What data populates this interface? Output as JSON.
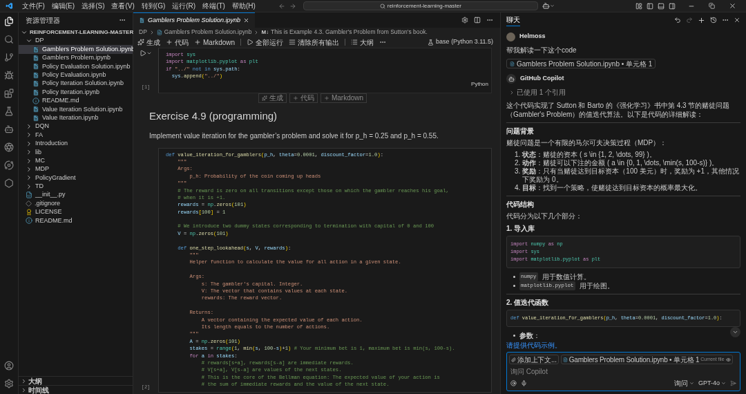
{
  "title_bar": {
    "menus": [
      "文件(F)",
      "编辑(E)",
      "选择(S)",
      "查看(V)",
      "转到(G)",
      "运行(R)",
      "终端(T)",
      "帮助(H)"
    ],
    "search": "reinforcement-learning-master"
  },
  "explorer": {
    "title": "资源管理器",
    "root": {
      "label": "REINFORCEMENT-LEARNING-MASTER",
      "expanded": true,
      "children": [
        {
          "kind": "folder",
          "label": "DP",
          "expanded": true,
          "selected": false,
          "children": [
            {
              "kind": "notebook",
              "label": "Gamblers Problem Solution.ipynb",
              "selected": true
            },
            {
              "kind": "notebook",
              "label": "Gamblers Problem.ipynb",
              "selected": false
            },
            {
              "kind": "notebook",
              "label": "Policy Evaluation Solution.ipynb",
              "selected": false
            },
            {
              "kind": "notebook",
              "label": "Policy Evaluation.ipynb",
              "selected": false
            },
            {
              "kind": "notebook",
              "label": "Policy Iteration Solution.ipynb",
              "selected": false
            },
            {
              "kind": "notebook",
              "label": "Policy Iteration.ipynb",
              "selected": false
            },
            {
              "kind": "info",
              "label": "README.md",
              "selected": false
            },
            {
              "kind": "notebook",
              "label": "Value Iteration Solution.ipynb",
              "selected": false
            },
            {
              "kind": "notebook",
              "label": "Value Iteration.ipynb",
              "selected": false
            }
          ]
        },
        {
          "kind": "folder",
          "label": "DQN",
          "expanded": false,
          "selected": false
        },
        {
          "kind": "folder",
          "label": "FA",
          "expanded": false,
          "selected": false
        },
        {
          "kind": "folder",
          "label": "Introduction",
          "expanded": false,
          "selected": false
        },
        {
          "kind": "folder",
          "label": "lib",
          "expanded": false,
          "selected": false
        },
        {
          "kind": "folder",
          "label": "MC",
          "expanded": false,
          "selected": false
        },
        {
          "kind": "folder",
          "label": "MDP",
          "expanded": false,
          "selected": false
        },
        {
          "kind": "folder",
          "label": "PolicyGradient",
          "expanded": false,
          "selected": false
        },
        {
          "kind": "folder",
          "label": "TD",
          "expanded": false,
          "selected": false
        },
        {
          "kind": "python",
          "label": "__init__.py",
          "selected": false
        },
        {
          "kind": "git",
          "label": ".gitignore",
          "selected": false
        },
        {
          "kind": "license",
          "label": "LICENSE",
          "selected": false
        },
        {
          "kind": "info",
          "label": "README.md",
          "selected": false
        }
      ]
    }
  },
  "bottom_sections": [
    {
      "label": "大纲",
      "expanded": false
    },
    {
      "label": "时间线",
      "expanded": false
    }
  ],
  "editor": {
    "tabs": [
      {
        "label": "Gamblers Problem Solution.ipynb",
        "selected": true
      }
    ],
    "breadcrumb": [
      "DP",
      "Gamblers Problem Solution.ipynb"
    ],
    "breadcrumb_badge": "M↓",
    "breadcrumb_cell": "This is Example 4.3. Gambler's Problem from Sutton's book.",
    "toolbar": [
      {
        "kind": "generate",
        "label": "生成"
      },
      {
        "kind": "add",
        "label": "代码"
      },
      {
        "kind": "add",
        "label": "Markdown"
      },
      {
        "kind": "separator"
      },
      {
        "kind": "run",
        "label": "全部运行"
      },
      {
        "kind": "clear",
        "label": "清除所有输出"
      },
      {
        "kind": "separator"
      },
      {
        "kind": "outline",
        "label": "大纲"
      },
      {
        "kind": "more"
      }
    ],
    "kernel": "base (Python 3.11.5)",
    "cells": [
      {
        "kind": "code",
        "focused": true,
        "exec": "[1]",
        "language": "Python",
        "lines": [
          {
            "kind": "code",
            "tokens": [
              {
                "kind": "ctl",
                "text": "import"
              },
              {
                "kind": "mod",
                "text": " sys"
              }
            ]
          },
          {
            "kind": "code",
            "tokens": [
              {
                "kind": "ctl",
                "text": "import"
              },
              {
                "kind": "mod",
                "text": " matplotlib.pyplot"
              },
              {
                "kind": "ctl",
                "text": " as"
              },
              {
                "kind": "mod",
                "text": " plt"
              }
            ]
          },
          {
            "kind": "code",
            "tokens": [
              {
                "kind": "ctl",
                "text": "if"
              },
              {
                "kind": "str",
                "text": " \"../\""
              },
              {
                "kind": "kw",
                "text": " not in"
              },
              {
                "kind": "var",
                "text": " sys"
              },
              {
                "kind": "plain",
                "text": "."
              },
              {
                "kind": "var",
                "text": "path"
              },
              {
                "kind": "plain",
                "text": ":"
              }
            ]
          },
          {
            "kind": "code",
            "tokens": [
              {
                "kind": "var",
                "text": "  sys"
              },
              {
                "kind": "plain",
                "text": "."
              },
              {
                "kind": "fn",
                "text": "append"
              },
              {
                "kind": "brk",
                "text": "("
              },
              {
                "kind": "str",
                "text": "\"../\""
              },
              {
                "kind": "brk",
                "text": ")"
              }
            ]
          }
        ]
      },
      {
        "kind": "insert_bar",
        "items": [
          "生成",
          "代码",
          "Markdown"
        ]
      },
      {
        "kind": "markdown",
        "heading": "Exercise 4.9 (programming)",
        "text": "Implement value iteration for the gambler’s problem and solve it for p_h = 0.25 and p_h = 0.55."
      },
      {
        "kind": "code",
        "focused": false,
        "exec": "[2]",
        "lines": [
          {
            "kind": "code",
            "tokens": [
              {
                "kind": "kw",
                "text": "def"
              },
              {
                "kind": "fn",
                "text": " value_iteration_for_gamblers"
              },
              {
                "kind": "brk",
                "text": "("
              },
              {
                "kind": "var",
                "text": "p_h"
              },
              {
                "kind": "plain",
                "text": ", "
              },
              {
                "kind": "var",
                "text": "theta"
              },
              {
                "kind": "plain",
                "text": "="
              },
              {
                "kind": "num",
                "text": "0.0001"
              },
              {
                "kind": "plain",
                "text": ", "
              },
              {
                "kind": "var",
                "text": "discount_factor"
              },
              {
                "kind": "plain",
                "text": "="
              },
              {
                "kind": "num",
                "text": "1.0"
              },
              {
                "kind": "brk",
                "text": ")"
              },
              {
                "kind": "plain",
                "text": ":"
              }
            ]
          },
          {
            "kind": "doc",
            "text": "    \"\"\""
          },
          {
            "kind": "doc",
            "text": "    Args:"
          },
          {
            "kind": "doc",
            "text": "        p_h: Probability of the coin coming up heads"
          },
          {
            "kind": "doc",
            "text": "    \"\"\""
          },
          {
            "kind": "cmt",
            "text": "    # The reward is zero on all transitions except those on which the gambler reaches his goal,"
          },
          {
            "kind": "cmt",
            "text": "    # when it is +1."
          },
          {
            "kind": "code",
            "tokens": [
              {
                "kind": "var",
                "text": "    rewards"
              },
              {
                "kind": "plain",
                "text": " = "
              },
              {
                "kind": "mod",
                "text": "np"
              },
              {
                "kind": "plain",
                "text": "."
              },
              {
                "kind": "fn",
                "text": "zeros"
              },
              {
                "kind": "brk",
                "text": "("
              },
              {
                "kind": "num",
                "text": "101"
              },
              {
                "kind": "brk",
                "text": ")"
              }
            ]
          },
          {
            "kind": "code",
            "tokens": [
              {
                "kind": "var",
                "text": "    rewards"
              },
              {
                "kind": "brk",
                "text": "["
              },
              {
                "kind": "num",
                "text": "100"
              },
              {
                "kind": "brk",
                "text": "]"
              },
              {
                "kind": "plain",
                "text": " = "
              },
              {
                "kind": "num",
                "text": "1"
              }
            ]
          },
          {
            "kind": "blank"
          },
          {
            "kind": "cmt",
            "text": "    # We introduce two dummy states corresponding to termination with capital of 0 and 100"
          },
          {
            "kind": "code",
            "tokens": [
              {
                "kind": "var",
                "text": "    V"
              },
              {
                "kind": "plain",
                "text": " = "
              },
              {
                "kind": "mod",
                "text": "np"
              },
              {
                "kind": "plain",
                "text": "."
              },
              {
                "kind": "fn",
                "text": "zeros"
              },
              {
                "kind": "brk",
                "text": "("
              },
              {
                "kind": "num",
                "text": "101"
              },
              {
                "kind": "brk",
                "text": ")"
              }
            ]
          },
          {
            "kind": "blank"
          },
          {
            "kind": "code",
            "tokens": [
              {
                "kind": "kw",
                "text": "    def"
              },
              {
                "kind": "fn",
                "text": " one_step_lookahead"
              },
              {
                "kind": "brk",
                "text": "("
              },
              {
                "kind": "var",
                "text": "s"
              },
              {
                "kind": "plain",
                "text": ", "
              },
              {
                "kind": "var",
                "text": "V"
              },
              {
                "kind": "plain",
                "text": ", "
              },
              {
                "kind": "var",
                "text": "rewards"
              },
              {
                "kind": "brk",
                "text": ")"
              },
              {
                "kind": "plain",
                "text": ":"
              }
            ]
          },
          {
            "kind": "doc",
            "text": "        \"\"\""
          },
          {
            "kind": "doc",
            "text": "        Helper function to calculate the value for all action in a given state."
          },
          {
            "kind": "blank"
          },
          {
            "kind": "doc",
            "text": "        Args:"
          },
          {
            "kind": "doc",
            "text": "            s: The gambler's capital. Integer."
          },
          {
            "kind": "doc",
            "text": "            V: The vector that contains values at each state."
          },
          {
            "kind": "doc",
            "text": "            rewards: The reward vector."
          },
          {
            "kind": "blank"
          },
          {
            "kind": "doc",
            "text": "        Returns:"
          },
          {
            "kind": "doc",
            "text": "            A vector containing the expected value of each action."
          },
          {
            "kind": "doc",
            "text": "            Its length equals to the number of actions."
          },
          {
            "kind": "doc",
            "text": "        \"\"\""
          },
          {
            "kind": "code",
            "tokens": [
              {
                "kind": "var",
                "text": "        A"
              },
              {
                "kind": "plain",
                "text": " = "
              },
              {
                "kind": "mod",
                "text": "np"
              },
              {
                "kind": "plain",
                "text": "."
              },
              {
                "kind": "fn",
                "text": "zeros"
              },
              {
                "kind": "brk",
                "text": "("
              },
              {
                "kind": "num",
                "text": "101"
              },
              {
                "kind": "brk",
                "text": ")"
              }
            ]
          },
          {
            "kind": "code",
            "tokens": [
              {
                "kind": "var",
                "text": "        stakes"
              },
              {
                "kind": "plain",
                "text": " = "
              },
              {
                "kind": "mod",
                "text": "range"
              },
              {
                "kind": "brk",
                "text": "("
              },
              {
                "kind": "num",
                "text": "1"
              },
              {
                "kind": "plain",
                "text": ", "
              },
              {
                "kind": "fn",
                "text": "min"
              },
              {
                "kind": "brk",
                "text": "("
              },
              {
                "kind": "var",
                "text": "s"
              },
              {
                "kind": "plain",
                "text": ", "
              },
              {
                "kind": "num",
                "text": "100"
              },
              {
                "kind": "plain",
                "text": "-"
              },
              {
                "kind": "var",
                "text": "s"
              },
              {
                "kind": "brk",
                "text": ")"
              },
              {
                "kind": "plain",
                "text": "+"
              },
              {
                "kind": "num",
                "text": "1"
              },
              {
                "kind": "brk",
                "text": ")"
              },
              {
                "kind": "cmt",
                "text": " # Your minimum bet is 1, maximum bet is min(s, 100-s)."
              }
            ]
          },
          {
            "kind": "code",
            "tokens": [
              {
                "kind": "ctl",
                "text": "        for"
              },
              {
                "kind": "var",
                "text": " a"
              },
              {
                "kind": "ctl",
                "text": " in"
              },
              {
                "kind": "var",
                "text": " stakes"
              },
              {
                "kind": "plain",
                "text": ":"
              }
            ]
          },
          {
            "kind": "cmt",
            "text": "            # rewards[s+a], rewards[s-a] are immediate rewards."
          },
          {
            "kind": "cmt",
            "text": "            # V[s+a], V[s-a] are values of the next states."
          },
          {
            "kind": "cmt",
            "text": "            # This is the core of the Bellman equation: The expected value of your action is"
          },
          {
            "kind": "cmt",
            "text": "            # the sum of immediate rewards and the value of the next state."
          }
        ]
      }
    ]
  },
  "chat": {
    "tabs": [
      {
        "label": "聊天",
        "selected": true
      }
    ],
    "messages": [
      {
        "kind": "user",
        "author": "Helmoss",
        "text": "帮我解读一下这个code",
        "attachment": "Gamblers Problem Solution.ipynb • 单元格 1"
      },
      {
        "kind": "assistant",
        "author": "GitHub Copilot",
        "references": {
          "label": "已使用 1 个引用",
          "expanded": false
        },
        "blocks": [
          {
            "kind": "paragraph",
            "text": "这个代码实现了 Sutton 和 Barto 的《强化学习》书中第 4.3 节的赌徒问题（Gambler's Problem）的值迭代算法。以下是代码的详细解读："
          },
          {
            "kind": "rule"
          },
          {
            "kind": "heading",
            "text": "问题背景"
          },
          {
            "kind": "paragraph",
            "text": "赌徒问题是一个有限的马尔可夫决策过程（MDP）："
          },
          {
            "kind": "olist",
            "items": [
              {
                "number": "1.",
                "text": "**状态**：赌徒的资本 ( s \\in {1, 2, \\dots, 99} )。"
              },
              {
                "number": "2.",
                "text": "**动作**：赌徒可以下注的金额 ( a \\in {0, 1, \\dots, \\min(s, 100-s)} )。"
              },
              {
                "number": "3.",
                "text": "**奖励**：只有当赌徒达到目标资本（100 美元）时，奖励为 +1，其他情况下奖励为 0。"
              },
              {
                "number": "4.",
                "text": "**目标**：找到一个策略，使赌徒达到目标资本的概率最大化。"
              }
            ]
          },
          {
            "kind": "rule"
          },
          {
            "kind": "heading",
            "text": "代码结构"
          },
          {
            "kind": "paragraph",
            "text": "代码分为以下几个部分："
          },
          {
            "kind": "heading",
            "text": "1. 导入库"
          },
          {
            "kind": "code",
            "lines": [
              {
                "kind": "code",
                "tokens": [
                  {
                    "kind": "ctl",
                    "text": "import"
                  },
                  {
                    "kind": "mod",
                    "text": " numpy"
                  },
                  {
                    "kind": "ctl",
                    "text": " as"
                  },
                  {
                    "kind": "mod",
                    "text": " np"
                  }
                ]
              },
              {
                "kind": "code",
                "tokens": [
                  {
                    "kind": "ctl",
                    "text": "import"
                  },
                  {
                    "kind": "mod",
                    "text": " sys"
                  }
                ]
              },
              {
                "kind": "code",
                "tokens": [
                  {
                    "kind": "ctl",
                    "text": "import"
                  },
                  {
                    "kind": "mod",
                    "text": " matplotlib.pyplot"
                  },
                  {
                    "kind": "ctl",
                    "text": " as"
                  },
                  {
                    "kind": "mod",
                    "text": " plt"
                  }
                ]
              }
            ]
          },
          {
            "kind": "ulist",
            "items": [
              {
                "code": "numpy",
                "text": "用于数值计算。"
              },
              {
                "code": "matplotlib.pyplot",
                "text": "用于绘图。"
              }
            ]
          },
          {
            "kind": "rule"
          },
          {
            "kind": "heading",
            "text": "2. 值迭代函数"
          },
          {
            "kind": "code",
            "lines": [
              {
                "kind": "code",
                "tokens": [
                  {
                    "kind": "kw",
                    "text": "def"
                  },
                  {
                    "kind": "fn",
                    "text": " value_iteration_for_gamblers"
                  },
                  {
                    "kind": "brk",
                    "text": "("
                  },
                  {
                    "kind": "var",
                    "text": "p_h"
                  },
                  {
                    "kind": "plain",
                    "text": ", "
                  },
                  {
                    "kind": "var",
                    "text": "theta"
                  },
                  {
                    "kind": "plain",
                    "text": "="
                  },
                  {
                    "kind": "num",
                    "text": "0.0001"
                  },
                  {
                    "kind": "plain",
                    "text": ", "
                  },
                  {
                    "kind": "var",
                    "text": "discount_factor"
                  },
                  {
                    "kind": "plain",
                    "text": "="
                  },
                  {
                    "kind": "num",
                    "text": "1.0"
                  },
                  {
                    "kind": "brk",
                    "text": ")"
                  },
                  {
                    "kind": "plain",
                    "text": ":"
                  }
                ]
              }
            ]
          },
          {
            "kind": "ulist",
            "items": [
              {
                "text": "**参数**："
              }
            ]
          }
        ]
      }
    ],
    "suggestion": "请提供代码示例。",
    "input": {
      "chips": [
        {
          "kind": "add",
          "label": "添加上下文..."
        },
        {
          "kind": "file",
          "label": "Gamblers Problem Solution.ipynb • 单元格 1",
          "note": "Current file"
        }
      ],
      "placeholder": "询问 Copilot",
      "mode": "询问",
      "model": "GPT-4o"
    }
  }
}
